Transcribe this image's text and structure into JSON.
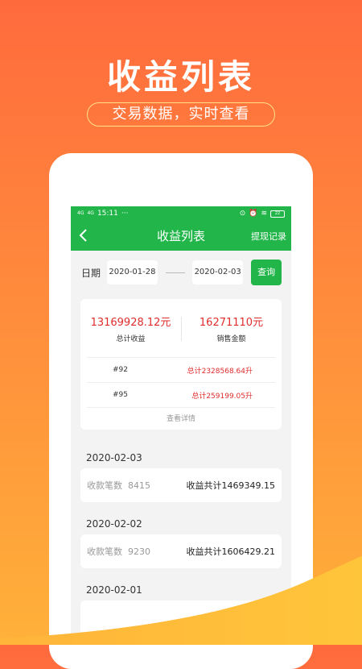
{
  "promo": {
    "title": "收益列表",
    "subtitle": "交易数据，实时查看"
  },
  "status_bar": {
    "net1": "4G",
    "net2": "4G",
    "time": "15:11",
    "more": "···",
    "battery": "22"
  },
  "nav": {
    "title": "收益列表",
    "right": "提现记录"
  },
  "filter": {
    "date_label": "日期",
    "start_date": "2020-01-28",
    "end_date": "2020-02-03",
    "query_label": "查询"
  },
  "summary": {
    "total_income_value": "13169928.12元",
    "total_income_label": "总计收益",
    "sales_value": "16271110元",
    "sales_label": "销售金额",
    "rows": [
      {
        "id": "#92",
        "amount": "总计2328568.64升"
      },
      {
        "id": "#95",
        "amount": "总计259199.05升"
      }
    ],
    "view_details": "查看详情"
  },
  "days": [
    {
      "date": "2020-02-03",
      "count_label": "收款笔数",
      "count": "8415",
      "total": "收益共计1469349.15"
    },
    {
      "date": "2020-02-02",
      "count_label": "收款笔数",
      "count": "9230",
      "total": "收益共计1606429.21"
    },
    {
      "date": "2020-02-01",
      "count_label": "",
      "count": "",
      "total": ""
    }
  ],
  "colors": {
    "brand_green": "#22b64a",
    "accent_red": "#e02d2d",
    "background_orange": "#ff6a3d",
    "background_yellow": "#ffb13a"
  }
}
